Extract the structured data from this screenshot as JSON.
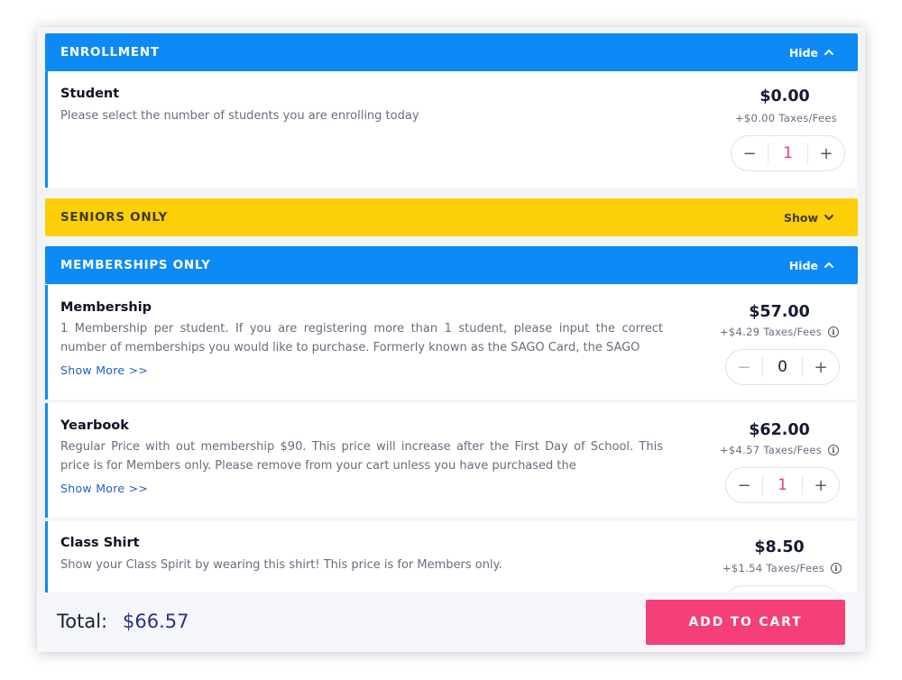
{
  "colors": {
    "header_blue": "#0d8af5",
    "header_yellow": "#fccf09",
    "qty_pink": "#f03d77",
    "cart_button": "#f43f78",
    "total_value": "#2a3180",
    "show_more_link": "#1f5fc4"
  },
  "sections": {
    "enrollment": {
      "title": "ENROLLMENT",
      "toggle": "Hide",
      "toggle_icon": "chevron-up-icon"
    },
    "seniors": {
      "title": "SENIORS ONLY",
      "toggle": "Show",
      "toggle_icon": "chevron-down-icon"
    },
    "memberships": {
      "title": "MEMBERSHIPS ONLY",
      "toggle": "Hide",
      "toggle_icon": "chevron-up-icon"
    }
  },
  "items": {
    "student": {
      "name": "Student",
      "description": "Please select the number of students you are enrolling today",
      "price": "$0.00",
      "fees": "+$0.00 Taxes/Fees",
      "quantity": "1",
      "minus": "−",
      "plus": "+"
    },
    "membership": {
      "name": "Membership",
      "description": "1 Membership per student. If you are registering more than 1 student, please input the correct number of memberships you would like to purchase. Formerly known as the SAGO Card, the SAGO",
      "show_more": "Show More >>",
      "price": "$57.00",
      "fees": "+$4.29 Taxes/Fees",
      "quantity": "0",
      "minus": "−",
      "plus": "+"
    },
    "yearbook": {
      "name": "Yearbook",
      "description": "Regular Price with out membership $90. This price will increase after the First Day of School. This price is for Members only. Please remove from your cart unless you have purchased the",
      "show_more": "Show More >>",
      "price": "$62.00",
      "fees": "+$4.57 Taxes/Fees",
      "quantity": "1",
      "minus": "−",
      "plus": "+"
    },
    "class_shirt": {
      "name": "Class Shirt",
      "description": "Show your Class Spirit by wearing this shirt! This price is for Members only.",
      "price": "$8.50",
      "fees": "+$1.54 Taxes/Fees"
    }
  },
  "info_icon_glyph": "i",
  "footer": {
    "total_label": "Total:",
    "total_value": "$66.57",
    "add_to_cart": "ADD TO CART"
  }
}
